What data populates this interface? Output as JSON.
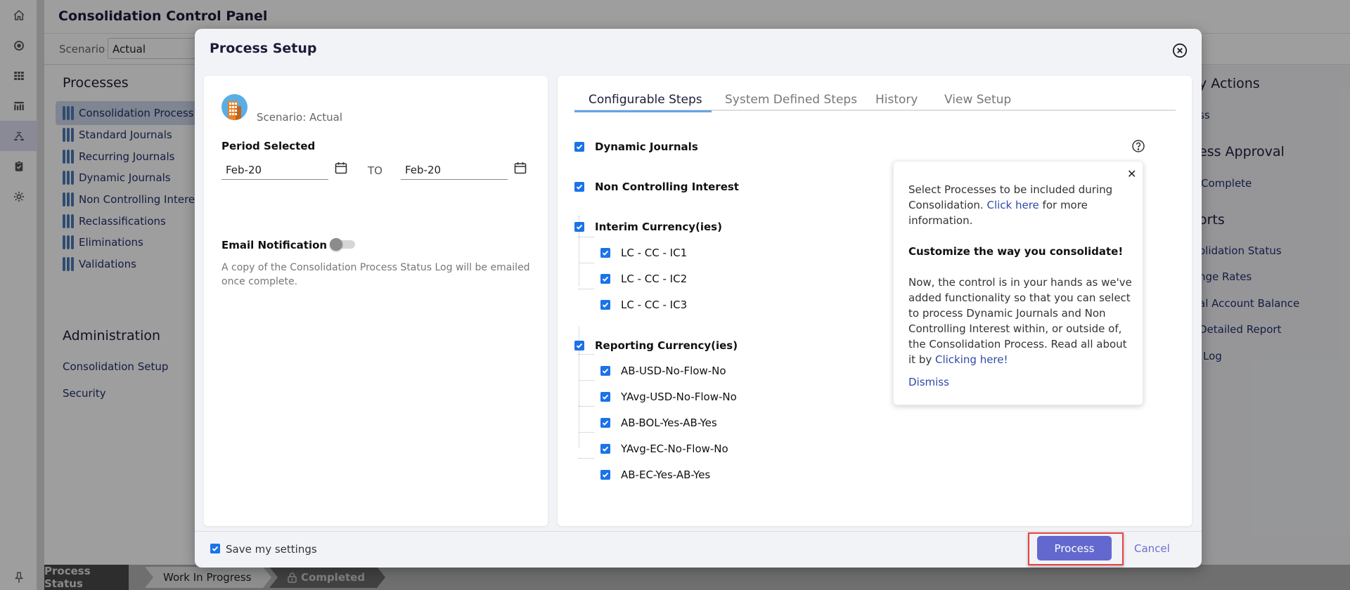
{
  "rail": {
    "icons": [
      "home-icon",
      "target-icon",
      "grid-icon",
      "building-chart-icon",
      "hierarchy-icon",
      "clipboard-check-icon",
      "gear-icon"
    ],
    "active_index": 4,
    "pin_icon": "pin-icon"
  },
  "app": {
    "title": "Consolidation Control Panel",
    "scenario_label": "Scenario",
    "scenario_value": "Actual",
    "processes_title": "Processes",
    "processes": [
      "Consolidation Process",
      "Standard Journals",
      "Recurring Journals",
      "Dynamic Journals",
      "Non Controlling Interest",
      "Reclassifications",
      "Eliminations",
      "Validations"
    ],
    "active_process_index": 0,
    "administration_title": "Administration",
    "administration_links": [
      "Consolidation Setup",
      "Security"
    ],
    "right_fragments": [
      {
        "text": "y Actions",
        "heading": true
      },
      {
        "text": "ss",
        "heading": false
      },
      {
        "text": "ess Approval",
        "heading": true
      },
      {
        "text": "Complete",
        "heading": false
      },
      {
        "text": "orts",
        "heading": true
      },
      {
        "text": "olidation Status",
        "heading": false
      },
      {
        "text": "nge Rates",
        "heading": false
      },
      {
        "text": "al Account Balance",
        "heading": false
      },
      {
        "text": "Detailed Report",
        "heading": false
      },
      {
        "text": "Log",
        "heading": false
      }
    ]
  },
  "status_bar": {
    "label": "Process Status",
    "steps": [
      "Work In Progress",
      "Completed"
    ],
    "completed_locked": true
  },
  "modal": {
    "title": "Process Setup",
    "scenario_text": "Scenario: Actual",
    "period_label": "Period Selected",
    "period_from": "Feb-20",
    "period_to_label": "TO",
    "period_to": "Feb-20",
    "email_label": "Email Notification",
    "email_enabled": false,
    "email_desc": "A copy of the Consolidation Process Status Log will be emailed once complete.",
    "tabs": [
      "Configurable Steps",
      "System Defined Steps",
      "History",
      "View Setup"
    ],
    "active_tab": 0,
    "steps": [
      {
        "label": "Dynamic Journals",
        "checked": true
      },
      {
        "label": "Non Controlling Interest",
        "checked": true
      },
      {
        "label": "Interim Currency(ies)",
        "checked": true,
        "children": [
          {
            "label": "LC - CC - IC1",
            "checked": true
          },
          {
            "label": "LC - CC - IC2",
            "checked": true
          },
          {
            "label": "LC - CC - IC3",
            "checked": true
          }
        ]
      },
      {
        "label": "Reporting Currency(ies)",
        "checked": true,
        "children": [
          {
            "label": "AB-USD-No-Flow-No",
            "checked": true
          },
          {
            "label": "YAvg-USD-No-Flow-No",
            "checked": true
          },
          {
            "label": "AB-BOL-Yes-AB-Yes",
            "checked": true
          },
          {
            "label": "YAvg-EC-No-Flow-No",
            "checked": true
          },
          {
            "label": "AB-EC-Yes-AB-Yes",
            "checked": true
          }
        ]
      }
    ],
    "popover": {
      "p1_before": "Select Processes to be included during Consolidation. ",
      "p1_link": "Click here",
      "p1_after": " for more information.",
      "heading": "Customize the way you consolidate!",
      "p2_before": "Now, the control is in your hands as we've added functionality so that you can select to process Dynamic Journals and Non Controlling Interest within, or outside of, the Consolidation Process. Read all about it by ",
      "p2_link": "Clicking here!",
      "dismiss": "Dismiss"
    },
    "save_settings_label": "Save my settings",
    "save_settings_checked": true,
    "process_button": "Process",
    "cancel_button": "Cancel"
  },
  "colors": {
    "accent": "#1a73e8",
    "primary_button": "#6368cf",
    "highlight_border": "#e8413e",
    "link": "#2f4aa8"
  }
}
